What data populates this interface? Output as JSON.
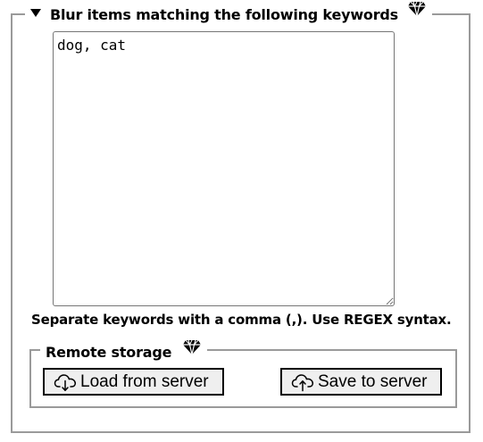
{
  "keywords_section": {
    "title": "Blur items matching the following keywords",
    "caret_icon": "caret-down-icon",
    "premium_icon": "diamond-icon",
    "textarea_value": "dog, cat",
    "help_text": "Separate keywords with a comma (,). Use REGEX syntax."
  },
  "remote_storage": {
    "title": "Remote storage",
    "premium_icon": "diamond-icon",
    "load_button": {
      "label": "Load from server",
      "icon": "cloud-download-icon"
    },
    "save_button": {
      "label": "Save to server",
      "icon": "cloud-upload-icon"
    }
  },
  "colors": {
    "border": "#9a9a9a",
    "button_bg": "#efefef",
    "text": "#000000"
  }
}
